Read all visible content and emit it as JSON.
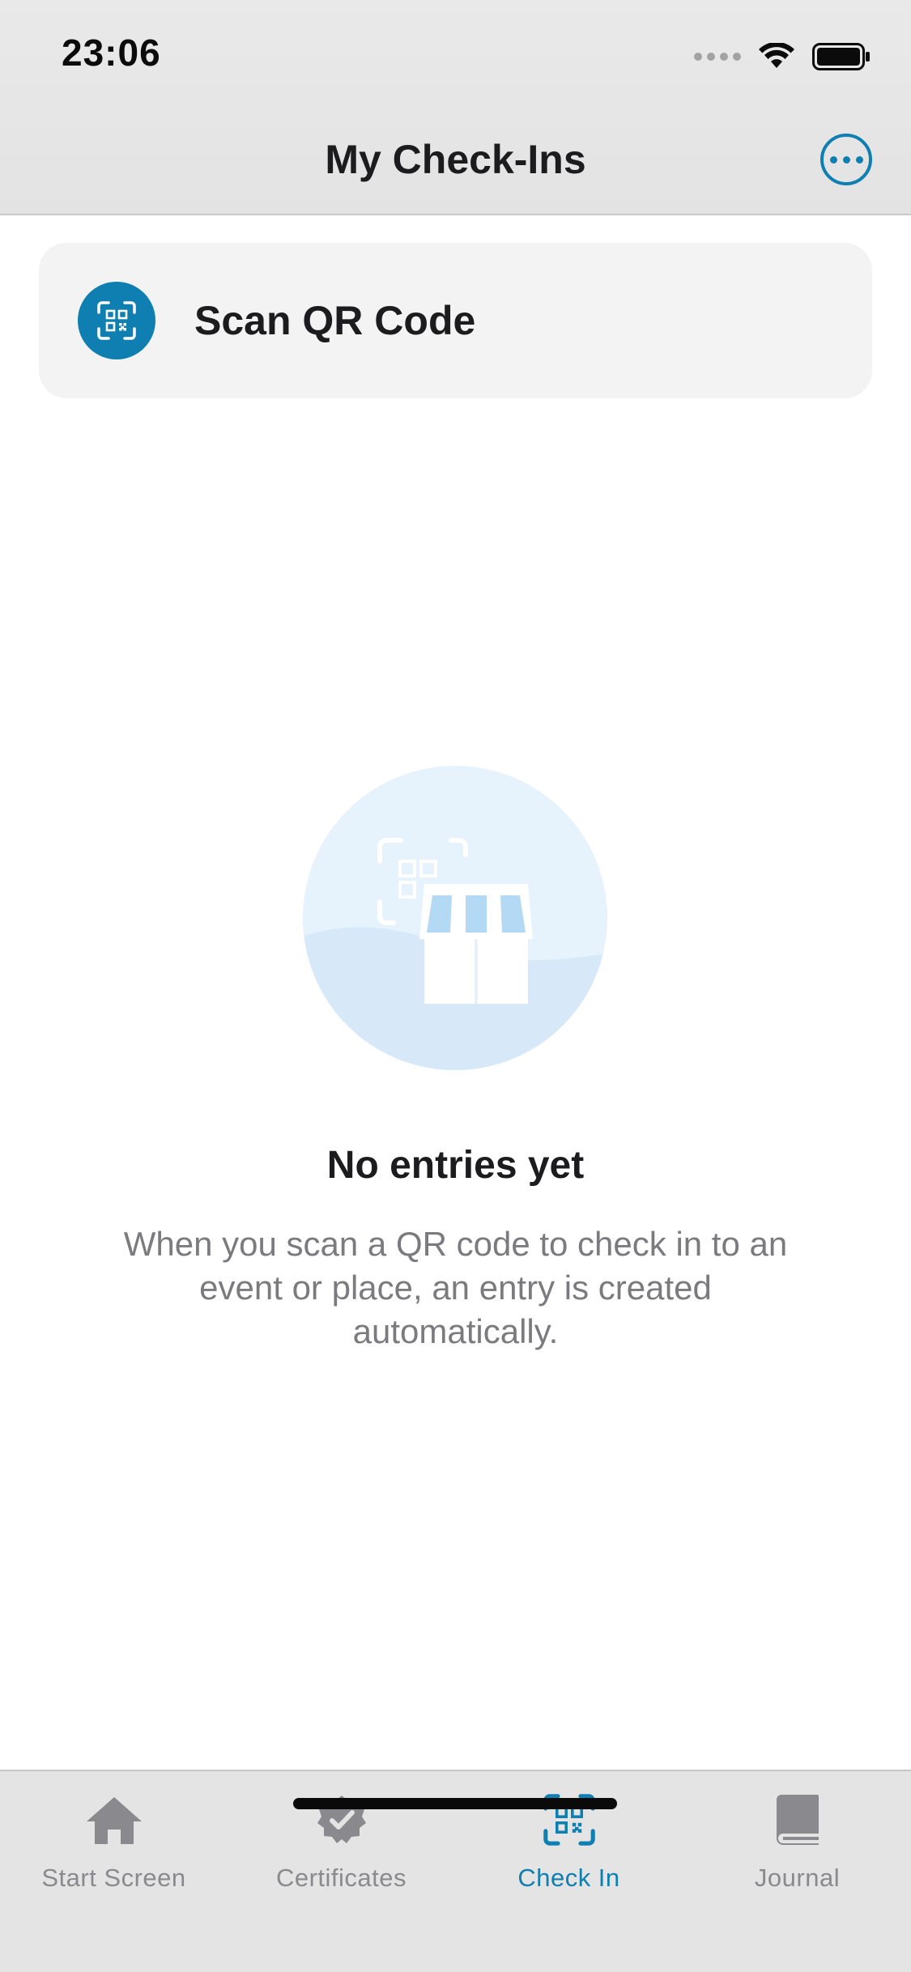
{
  "status_bar": {
    "time": "23:06"
  },
  "nav": {
    "title": "My Check-Ins",
    "more_icon": "ellipsis-circle-icon"
  },
  "scan_card": {
    "label": "Scan QR Code",
    "icon": "qr-scan-icon"
  },
  "empty_state": {
    "illustration": "storefront-qr-illustration",
    "title": "No entries yet",
    "description": "When you scan a QR code to check in to an event or place, an entry is created automatically."
  },
  "tabs": [
    {
      "label": "Start Screen",
      "icon": "house-icon",
      "active": false
    },
    {
      "label": "Certificates",
      "icon": "certificate-badge-icon",
      "active": false
    },
    {
      "label": "Check In",
      "icon": "qr-scan-icon",
      "active": true
    },
    {
      "label": "Journal",
      "icon": "book-icon",
      "active": false
    }
  ],
  "colors": {
    "accent": "#0e7fb0",
    "inactive": "#8a8a8e",
    "illustration_bg": "#e6f2fc"
  }
}
